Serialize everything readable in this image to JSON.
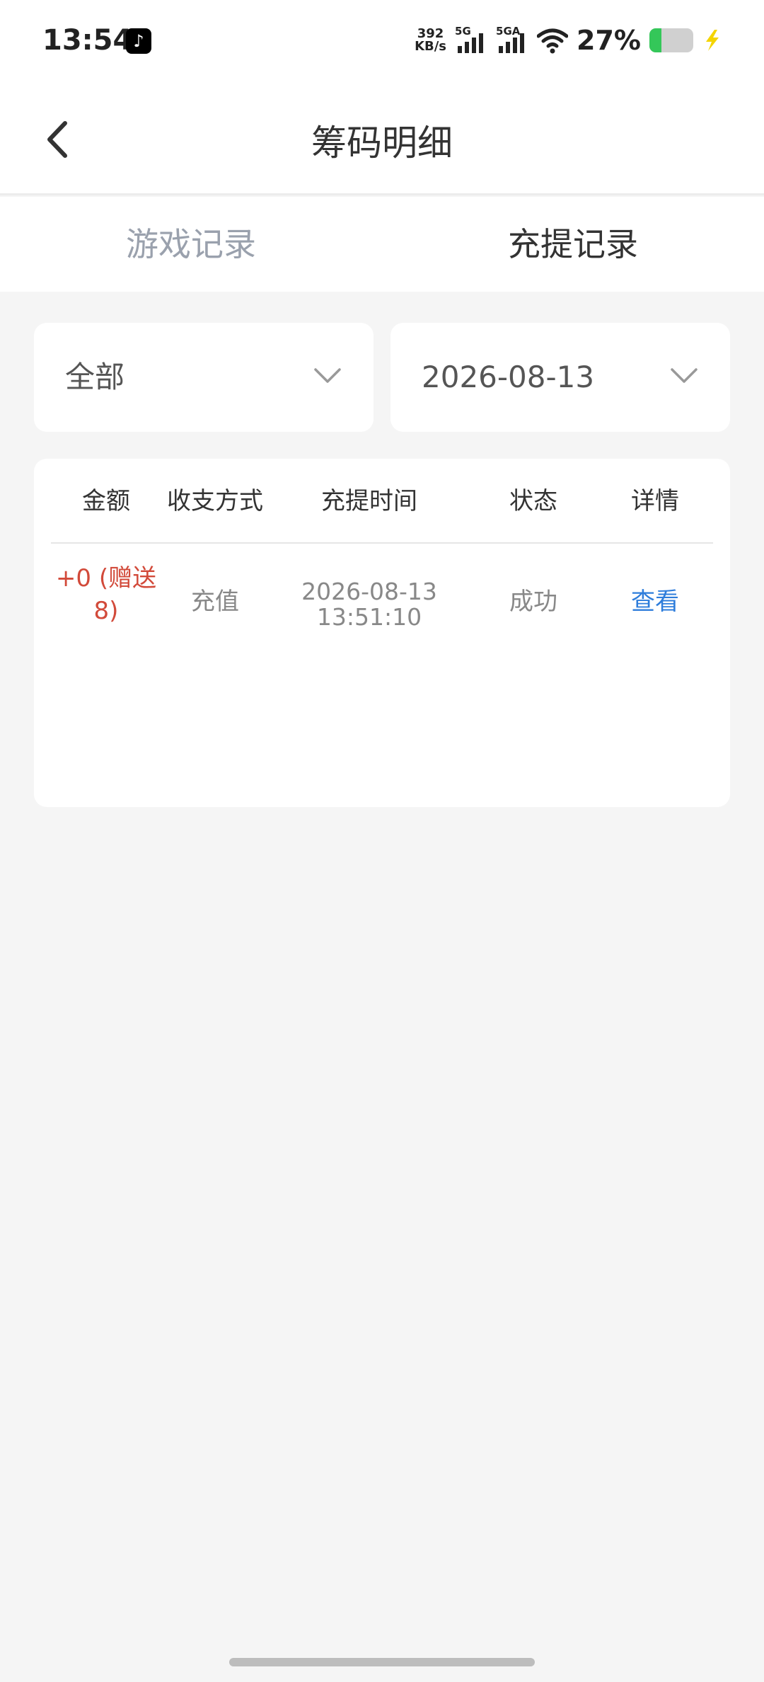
{
  "status_bar": {
    "time": "13:54",
    "speed_value": "392",
    "speed_unit": "KB/s",
    "sim1_label": "5G",
    "sim2_label": "5GA",
    "battery_percent": "27%",
    "battery_level": 0.27,
    "icons": [
      "tiktok-icon",
      "wifi-icon",
      "battery-icon",
      "bolt-icon"
    ]
  },
  "navbar": {
    "title": "筹码明细",
    "back_icon": "chevron-left-icon"
  },
  "tabs": [
    {
      "label": "游戏记录",
      "active": false
    },
    {
      "label": "充提记录",
      "active": true
    }
  ],
  "filters": {
    "type": {
      "value": "全部"
    },
    "date": {
      "value": "2026-08-13"
    }
  },
  "table": {
    "headers": [
      "金额",
      "收支方式",
      "充提时间",
      "状态",
      "详情"
    ],
    "rows": [
      {
        "amount_line1": "+0 (赠送",
        "amount_line2": "8)",
        "method": "充值",
        "date": "2026-08-13",
        "time": "13:51:10",
        "status": "成功",
        "detail": "查看"
      }
    ]
  },
  "colors": {
    "amount": "#d24a3a",
    "link": "#2e7ddb",
    "inactive_tab": "#9aa1ad",
    "background": "#f5f5f5"
  }
}
